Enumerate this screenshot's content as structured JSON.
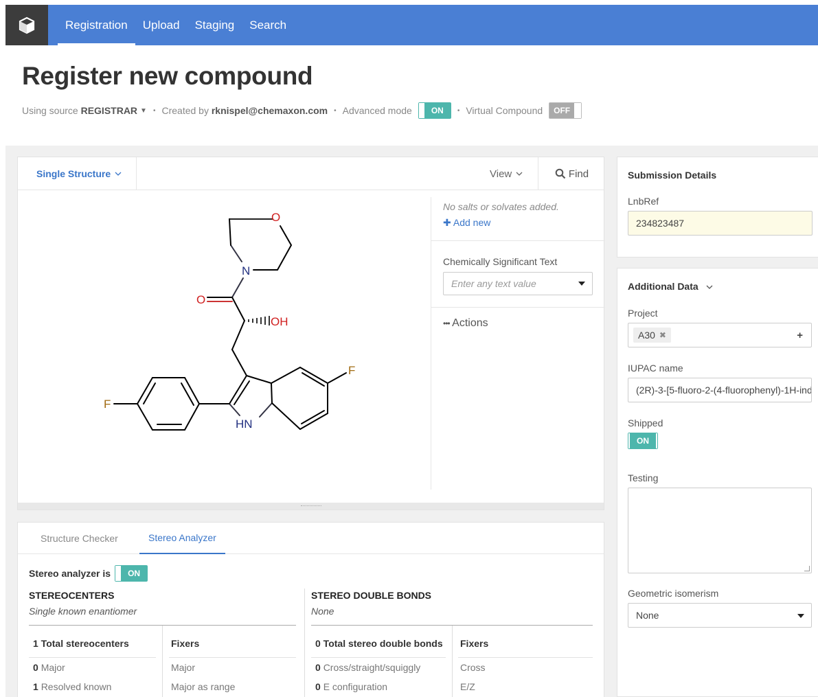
{
  "nav": {
    "items": [
      {
        "label": "Registration",
        "active": true
      },
      {
        "label": "Upload",
        "active": false
      },
      {
        "label": "Staging",
        "active": false
      },
      {
        "label": "Search",
        "active": false
      }
    ]
  },
  "header": {
    "title": "Register new compound",
    "using_source_label": "Using source",
    "source_value": "REGISTRAR",
    "created_by_label": "Created by",
    "created_by_value": "rknispel@chemaxon.com",
    "advanced_mode_label": "Advanced mode",
    "advanced_mode_state": "ON",
    "virtual_compound_label": "Virtual Compound",
    "virtual_compound_state": "OFF"
  },
  "structure_panel": {
    "mode_label": "Single Structure",
    "view_label": "View",
    "find_label": "Find",
    "salts_note": "No salts or solvates added.",
    "add_new_label": "Add new",
    "chem_text_label": "Chemically Significant Text",
    "chem_text_placeholder": "Enter any text value",
    "actions_label": "Actions",
    "atoms": {
      "o_ring": "O",
      "n_ring": "N",
      "o_carbonyl": "O",
      "oh": "OH",
      "f_left": "F",
      "f_right": "F",
      "nh": "HN"
    }
  },
  "analyzer": {
    "tabs": [
      {
        "label": "Structure Checker",
        "active": false
      },
      {
        "label": "Stereo Analyzer",
        "active": true
      }
    ],
    "status_label": "Stereo analyzer is",
    "status_state": "ON",
    "stereocenters": {
      "title": "STEREOCENTERS",
      "subtitle": "Single known enantiomer",
      "total": "1 Total stereocenters",
      "fixers_header": "Fixers",
      "rows": [
        {
          "count": "0",
          "label": "Major",
          "fixer": "Major"
        },
        {
          "count": "1",
          "label": "Resolved known",
          "fixer": "Major as range"
        }
      ]
    },
    "double_bonds": {
      "title": "STEREO DOUBLE BONDS",
      "subtitle": "None",
      "total": "0 Total stereo double bonds",
      "fixers_header": "Fixers",
      "rows": [
        {
          "count": "0",
          "label": "Cross/straight/squiggly",
          "fixer": "Cross"
        },
        {
          "count": "0",
          "label": "E configuration",
          "fixer": "E/Z"
        }
      ]
    }
  },
  "submission": {
    "title": "Submission Details",
    "lnbref_label": "LnbRef",
    "lnbref_value": "234823487"
  },
  "additional": {
    "title": "Additional Data",
    "project_label": "Project",
    "project_chip": "A30",
    "iupac_label": "IUPAC name",
    "iupac_value": "(2R)-3-[5-fluoro-2-(4-fluorophenyl)-1H-ind",
    "shipped_label": "Shipped",
    "shipped_state": "ON",
    "testing_label": "Testing",
    "testing_value": "",
    "geo_label": "Geometric isomerism",
    "geo_value": "None"
  }
}
